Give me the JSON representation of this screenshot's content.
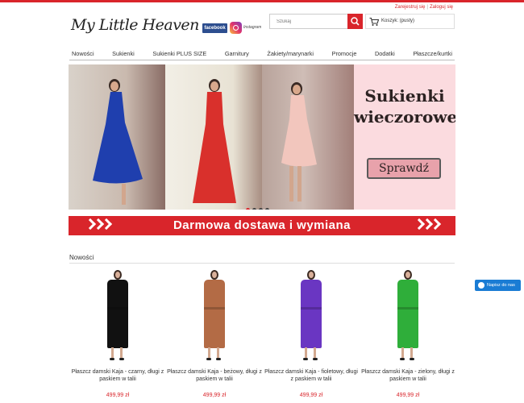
{
  "header": {
    "links": {
      "register": "Zarejestruj się",
      "separator": "|",
      "login": "Zaloguj się"
    },
    "logo_text": "My Little Heaven",
    "facebook_label": "facebook",
    "instagram_label": "Instagram",
    "search_placeholder": "Szukaj",
    "cart_label": "Koszyk: (pusty)",
    "accent_color": "#d9252b"
  },
  "nav": {
    "items": [
      "Nowości",
      "Sukienki",
      "Sukienki PLUS SIZE",
      "Garnitury",
      "Żakiety/marynarki",
      "Promocje",
      "Dodatki",
      "Płaszcze/kurtki"
    ]
  },
  "banner": {
    "title_line1": "Sukienki",
    "title_line2": "wieczorowe",
    "button_label": "Sprawdź",
    "dress_colors": [
      "#1f3fae",
      "#d9302c",
      "#f2c6bd"
    ],
    "slide_count": 4,
    "active_slide": 1
  },
  "shipping_banner": {
    "text": "Darmowa dostawa i wymiana"
  },
  "section": {
    "title": "Nowości"
  },
  "messenger": {
    "label": "Napisz do nas"
  },
  "products": [
    {
      "name": "Płaszcz damski Kaja - czarny, długi z paskiem w talii",
      "price": "499,99 zł",
      "color": "#111111"
    },
    {
      "name": "Płaszcz damski Kaja - beżowy, długi z paskiem w talii",
      "price": "499,99 zł",
      "color": "#b36b45"
    },
    {
      "name": "Płaszcz damski Kaja - fioletowy, długi z paskiem w talii",
      "price": "499,99 zł",
      "color": "#6a36c2"
    },
    {
      "name": "Płaszcz damski Kaja - zielony, długi z paskiem w talii",
      "price": "499,99 zł",
      "color": "#2fae3a"
    }
  ]
}
